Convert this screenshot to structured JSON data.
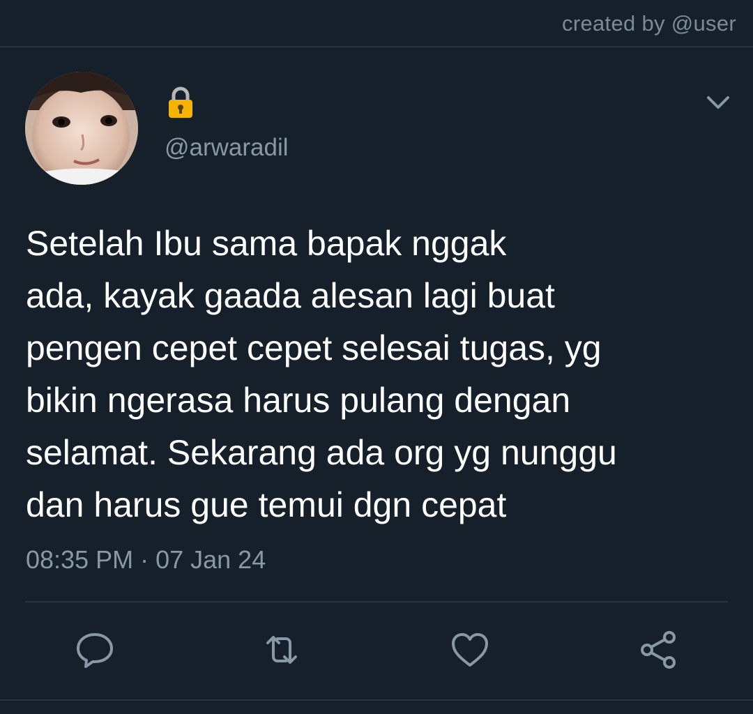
{
  "header": {
    "created_by": "created by @user"
  },
  "tweet": {
    "lock_icon": "lock-icon",
    "handle": "@arwaradil",
    "text_lines": [
      "Setelah Ibu sama bapak nggak",
      "ada, kayak gaada alesan lagi buat",
      "pengen cepet cepet selesai tugas, yg",
      "bikin ngerasa harus pulang dengan",
      "selamat. Sekarang ada org yg nunggu",
      "dan harus gue temui dgn cepat"
    ],
    "timestamp": "08:35 PM · 07 Jan 24"
  },
  "actions": [
    "reply-icon",
    "retweet-icon",
    "like-icon",
    "share-icon"
  ],
  "colors": {
    "background": "#15202b",
    "secondary_text": "#8899a6",
    "divider": "#2a3440",
    "lock_gold": "#f4b400"
  }
}
